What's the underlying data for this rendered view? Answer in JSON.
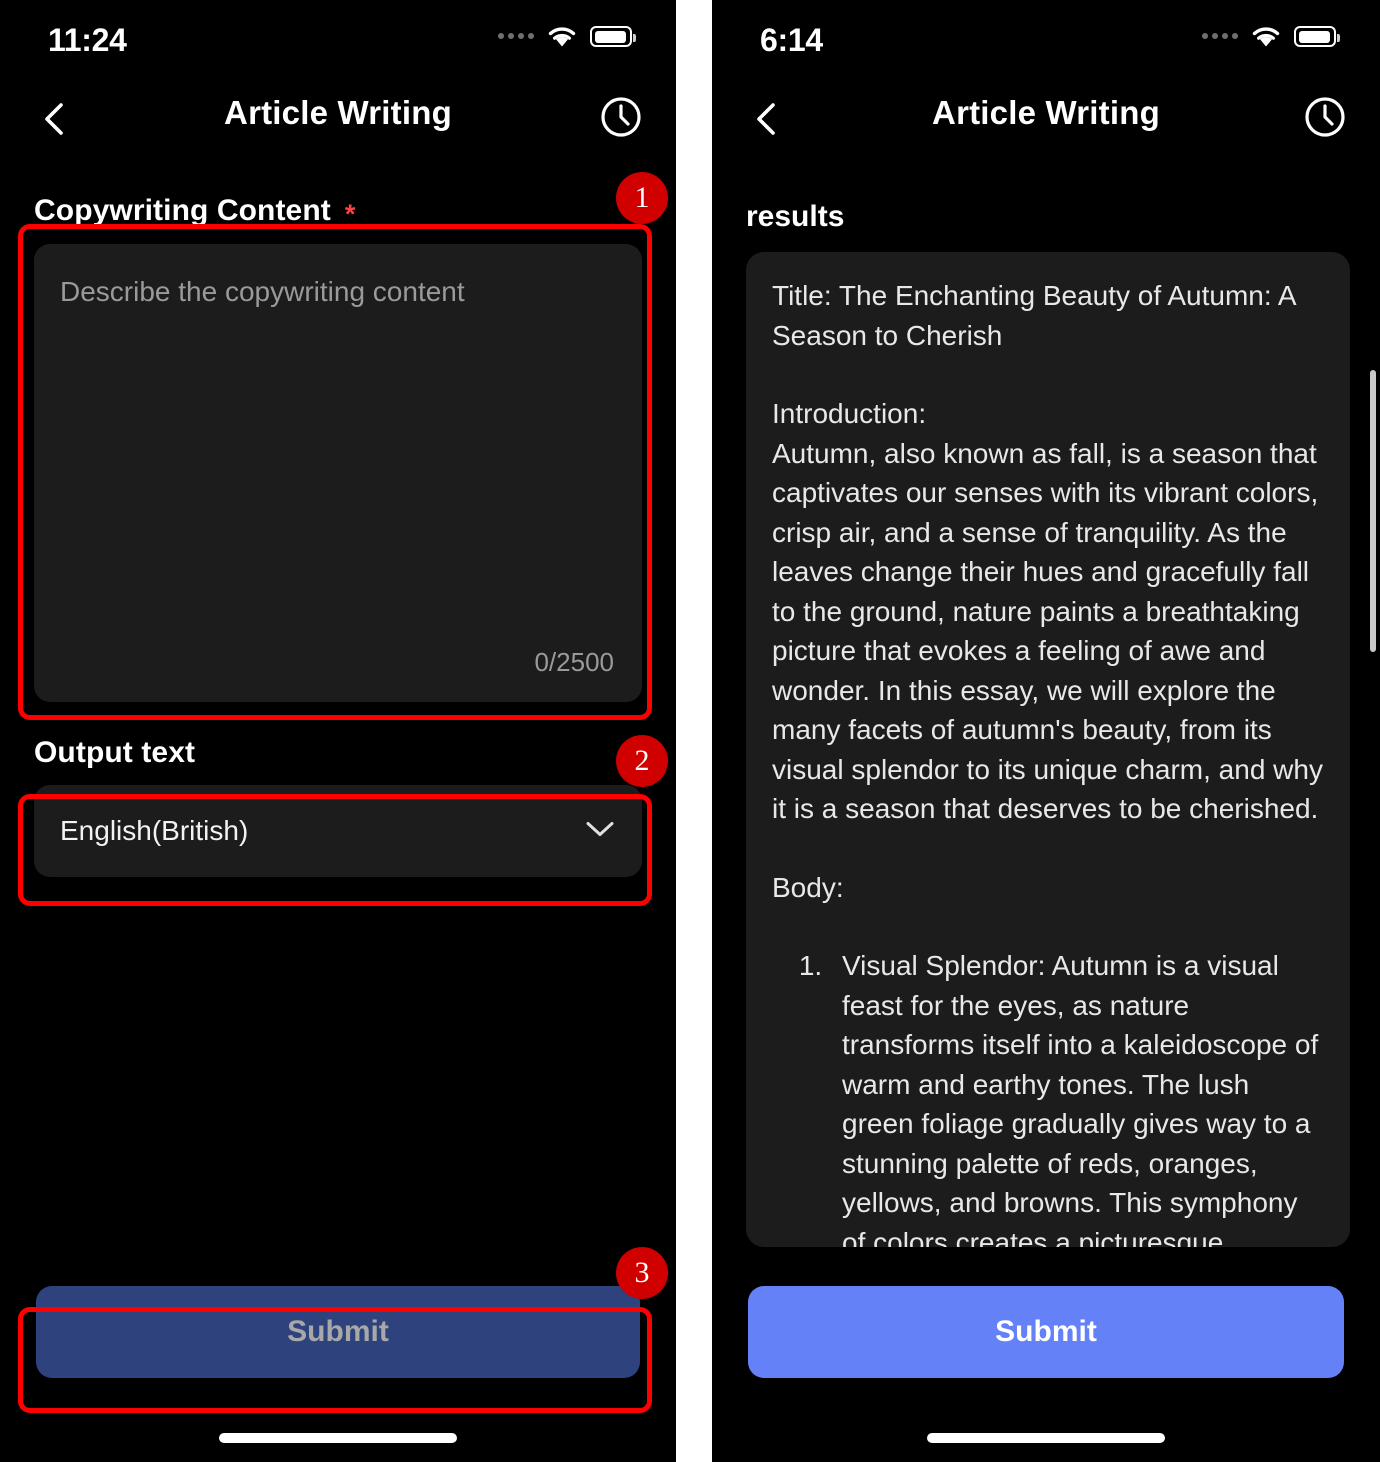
{
  "left_panel": {
    "status_bar": {
      "time": "11:24",
      "signal_icon": "signal-dots-icon",
      "wifi_icon": "wifi-icon",
      "battery_icon": "battery-icon"
    },
    "nav": {
      "back_icon": "chevron-left-icon",
      "title": "Article Writing",
      "history_icon": "clock-icon"
    },
    "copywriting": {
      "label": "Copywriting Content",
      "required_marker": "*",
      "placeholder": "Describe the copywriting content",
      "value": "",
      "char_count": "0/2500"
    },
    "output_text": {
      "label": "Output text",
      "selected": "English(British)",
      "chevron_icon": "chevron-down-icon"
    },
    "submit_label": "Submit"
  },
  "right_panel": {
    "status_bar": {
      "time": "6:14",
      "signal_icon": "signal-dots-icon",
      "wifi_icon": "wifi-icon",
      "battery_icon": "battery-icon"
    },
    "nav": {
      "back_icon": "chevron-left-icon",
      "title": "Article Writing",
      "history_icon": "clock-icon"
    },
    "results": {
      "label": "results",
      "title_line": "Title: The Enchanting Beauty of Autumn: A Season to Cherish",
      "introduction_heading": "Introduction:",
      "introduction_body": "Autumn, also known as fall, is a season that captivates our senses with its vibrant colors, crisp air, and a sense of tranquility. As the leaves change their hues and gracefully fall to the ground, nature paints a breathtaking picture that evokes a feeling of awe and wonder. In this essay, we will explore the many facets of autumn's beauty, from its visual splendor to its unique charm, and why it is a season that deserves to be cherished.",
      "body_heading": "Body:",
      "list_items": [
        "Visual Splendor:\nAutumn is a visual feast for the eyes, as nature transforms itself into a kaleidoscope of warm and earthy tones. The lush green foliage gradually gives way to a stunning palette of reds, oranges, yellows, and browns. This symphony of colors creates a picturesque landscape that is unparalleled in its beauty. The sight of trees adorned with vibrant leaves against a clear blue sky is a sight to behold."
      ]
    },
    "submit_label": "Submit"
  },
  "annotations": {
    "badges": [
      "1",
      "2",
      "3"
    ],
    "highlight_color": "#ff0000",
    "badge_color": "#d00000"
  }
}
